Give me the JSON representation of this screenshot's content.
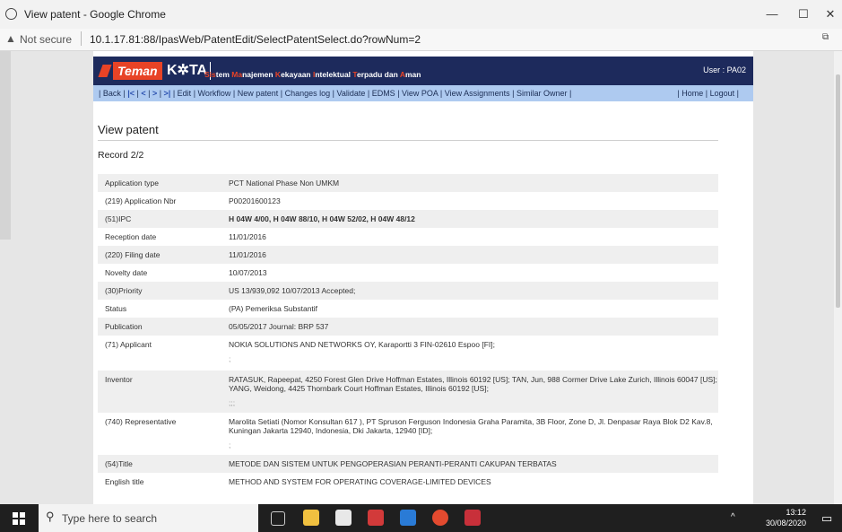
{
  "window": {
    "title": "View patent - Google Chrome",
    "controls": [
      "—",
      "☐",
      "✕"
    ]
  },
  "address": {
    "security": "Not secure",
    "url": "10.1.17.81:88/IpasWeb/PatentEdit/SelectPatentSelect.do?rowNum=2"
  },
  "header": {
    "logo_teman": "Teman",
    "logo_kita": "K✲TA",
    "tagline": [
      {
        "hi": "Sis",
        "lo": "tem "
      },
      {
        "hi": "Ma",
        "lo": "najemen "
      },
      {
        "hi": "K",
        "lo": "ekayaan "
      },
      {
        "hi": "I",
        "lo": "ntelektual "
      },
      {
        "hi": "T",
        "lo": "erpadu dan "
      },
      {
        "hi": "A",
        "lo": "man"
      }
    ],
    "user": "User : PA02"
  },
  "nav": {
    "left_items": [
      "Back",
      "|<",
      "<",
      ">",
      ">|",
      "Edit",
      "Workflow",
      "New patent",
      "Changes log",
      "Validate",
      "EDMS",
      "View POA",
      "View Assignments",
      "Similar Owner"
    ],
    "right_items": [
      "Home",
      "Logout"
    ]
  },
  "page": {
    "title": "View patent",
    "record": "Record 2/2"
  },
  "rows": [
    {
      "label": "Application type",
      "value": "PCT National Phase Non UMKM",
      "bold": false
    },
    {
      "label": "(219) Application Nbr",
      "value": "P00201600123",
      "bold": false
    },
    {
      "label": "(51)IPC",
      "value": "H 04W 4/00, H 04W 88/10, H 04W 52/02, H 04W 48/12",
      "bold": true
    },
    {
      "label": "Reception date",
      "value": "11/01/2016",
      "bold": false
    },
    {
      "label": "(220) Filing date",
      "value": "11/01/2016",
      "bold": false
    },
    {
      "label": "Novelty date",
      "value": "10/07/2013",
      "bold": false
    },
    {
      "label": "(30)Priority",
      "value": "US 13/939,092 10/07/2013 Accepted;",
      "bold": false
    },
    {
      "label": "Status",
      "value": "(PA) Pemeriksa Substantif",
      "bold": false
    },
    {
      "label": "Publication",
      "value": "05/05/2017 Journal: BRP 537",
      "bold": false
    },
    {
      "label": "(71) Applicant",
      "value": "NOKIA SOLUTIONS AND NETWORKS OY, Karaportti 3 FIN-02610 Espoo [FI];",
      "sub": ";",
      "bold": false,
      "multi": true
    },
    {
      "label": "Inventor",
      "value": "RATASUK, Rapeepat, 4250 Forest Glen Drive Hoffman Estates, Illinois 60192 [US]; TAN, Jun, 988 Cormer Drive Lake Zurich, Illinois 60047 [US]; YANG, Weidong, 4425 Thornbark Court Hoffman Estates, Illinois 60192 [US];",
      "sub": ";;;",
      "bold": false,
      "multi": true
    },
    {
      "label": "(740) Representative",
      "value": "Marolita Setiati (Nomor Konsultan 617 ), PT Spruson Ferguson Indonesia Graha Paramita, 3B Floor, Zone D, Jl. Denpasar Raya Blok D2 Kav.8, Kuningan Jakarta 12940, Indonesia, Dki Jakarta, 12940 [ID];",
      "sub": ";",
      "bold": false,
      "multi": true
    },
    {
      "label": "(54)Title",
      "value": "METODE DAN SISTEM UNTUK PENGOPERASIAN PERANTI-PERANTI CAKUPAN TERBATAS",
      "bold": false
    },
    {
      "label": "English title",
      "value": "METHOD AND SYSTEM FOR OPERATING COVERAGE-LIMITED DEVICES",
      "bold": false
    }
  ],
  "taskbar": {
    "search_placeholder": "Type here to search",
    "time": "13:12",
    "date": "30/08/2020"
  },
  "colors": {
    "header_bg": "#1d2a5c",
    "accent_orange": "#e84326",
    "nav_bg": "#aecaf0",
    "row_alt": "#efefef"
  }
}
